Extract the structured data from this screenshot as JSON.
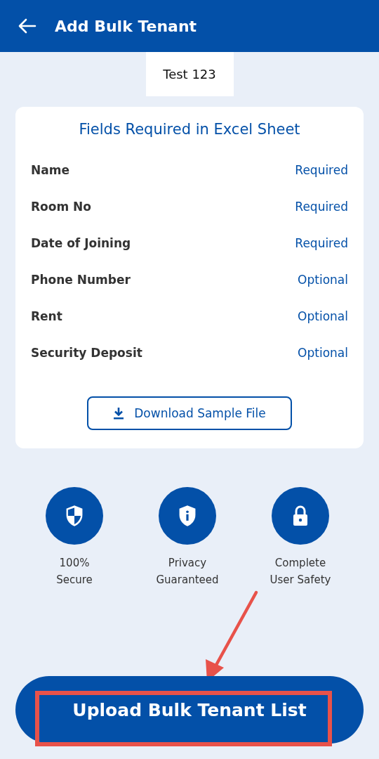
{
  "header": {
    "title": "Add Bulk Tenant"
  },
  "property_tab": {
    "label": "Test 123"
  },
  "fields_card": {
    "title": "Fields Required in Excel Sheet",
    "fields": [
      {
        "name": "Name",
        "status": "Required"
      },
      {
        "name": "Room No",
        "status": "Required"
      },
      {
        "name": "Date of Joining",
        "status": "Required"
      },
      {
        "name": "Phone Number",
        "status": "Optional"
      },
      {
        "name": "Rent",
        "status": "Optional"
      },
      {
        "name": "Security Deposit",
        "status": "Optional"
      }
    ],
    "download_button": "Download Sample File"
  },
  "features": [
    {
      "kind": "shield",
      "line1": "100%",
      "line2": "Secure"
    },
    {
      "kind": "info",
      "line1": "Privacy",
      "line2": "Guaranteed"
    },
    {
      "kind": "lock",
      "line1": "Complete",
      "line2": "User Safety"
    }
  ],
  "upload_button": "Upload Bulk Tenant List"
}
